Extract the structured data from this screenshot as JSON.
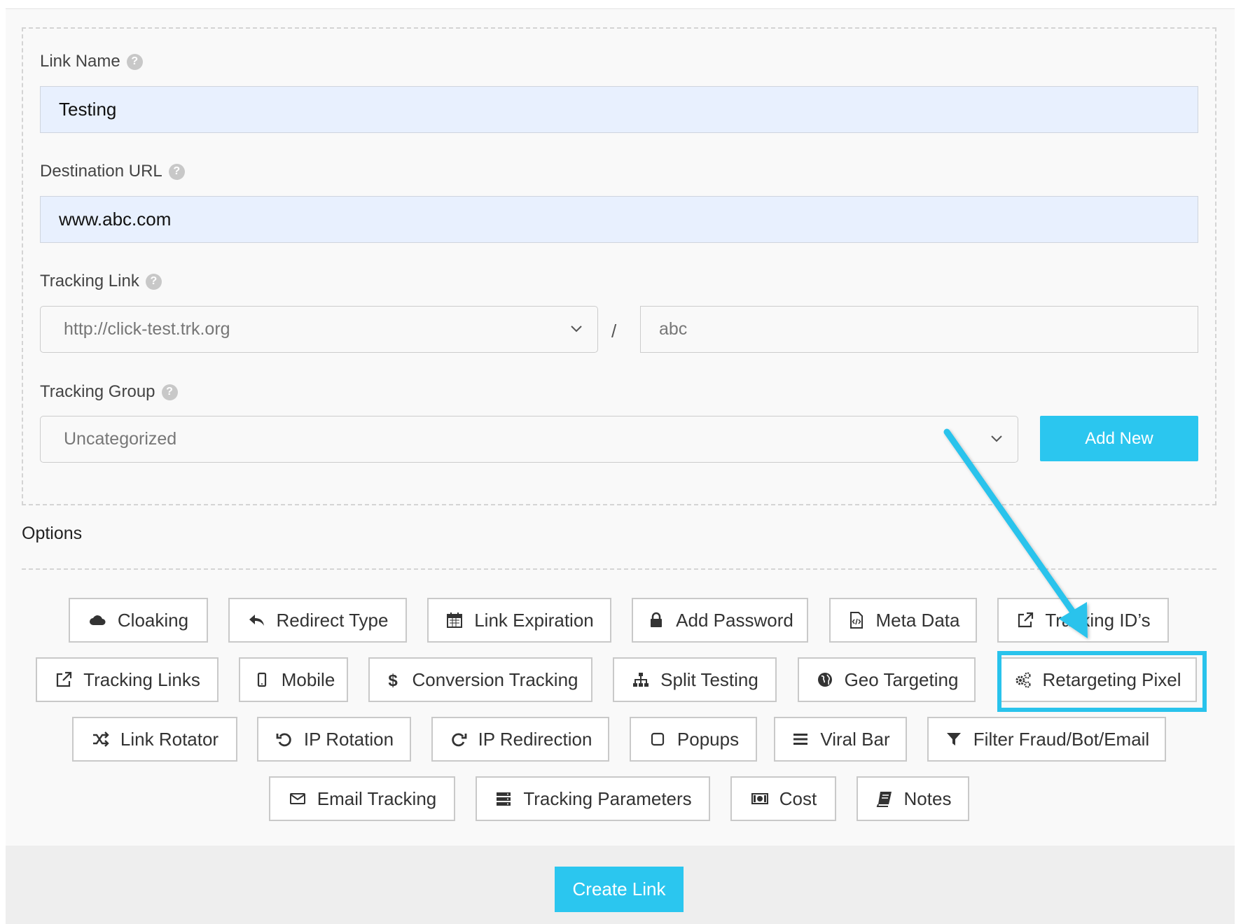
{
  "form": {
    "link_name": {
      "label": "Link Name",
      "value": "Testing"
    },
    "destination_url": {
      "label": "Destination URL",
      "value": "www.abc.com"
    },
    "tracking_link": {
      "label": "Tracking Link",
      "domain": "http://click-test.trk.org",
      "separator": "/",
      "slug": "abc"
    },
    "tracking_group": {
      "label": "Tracking Group",
      "value": "Uncategorized",
      "add_new_label": "Add New"
    }
  },
  "options": {
    "title": "Options",
    "buttons": [
      {
        "label": "Cloaking",
        "icon": "cloud-icon"
      },
      {
        "label": "Redirect Type",
        "icon": "reply-icon"
      },
      {
        "label": "Link Expiration",
        "icon": "calendar-icon"
      },
      {
        "label": "Add Password",
        "icon": "lock-icon"
      },
      {
        "label": "Meta Data",
        "icon": "code-file-icon"
      },
      {
        "label": "Tracking ID’s",
        "icon": "external-link-icon"
      },
      {
        "label": "Tracking Links",
        "icon": "external-link-icon"
      },
      {
        "label": "Mobile",
        "icon": "mobile-icon"
      },
      {
        "label": "Conversion Tracking",
        "icon": "dollar-icon"
      },
      {
        "label": "Split Testing",
        "icon": "sitemap-icon"
      },
      {
        "label": "Geo Targeting",
        "icon": "globe-icon"
      },
      {
        "label": "Retargeting Pixel",
        "icon": "cogs-icon"
      },
      {
        "label": "Link Rotator",
        "icon": "shuffle-icon"
      },
      {
        "label": "IP Rotation",
        "icon": "undo-icon"
      },
      {
        "label": "IP Redirection",
        "icon": "redo-icon"
      },
      {
        "label": "Popups",
        "icon": "square-icon"
      },
      {
        "label": "Viral Bar",
        "icon": "bars-icon"
      },
      {
        "label": "Filter Fraud/Bot/Email",
        "icon": "filter-icon"
      },
      {
        "label": "Email Tracking",
        "icon": "envelope-icon"
      },
      {
        "label": "Tracking Parameters",
        "icon": "server-icon"
      },
      {
        "label": "Cost",
        "icon": "money-icon"
      },
      {
        "label": "Notes",
        "icon": "book-icon"
      }
    ]
  },
  "footer": {
    "create_label": "Create Link"
  },
  "colors": {
    "accent": "#2bc6ef",
    "input_fill": "#e8f0fe",
    "highlight": "#29c3ec"
  }
}
